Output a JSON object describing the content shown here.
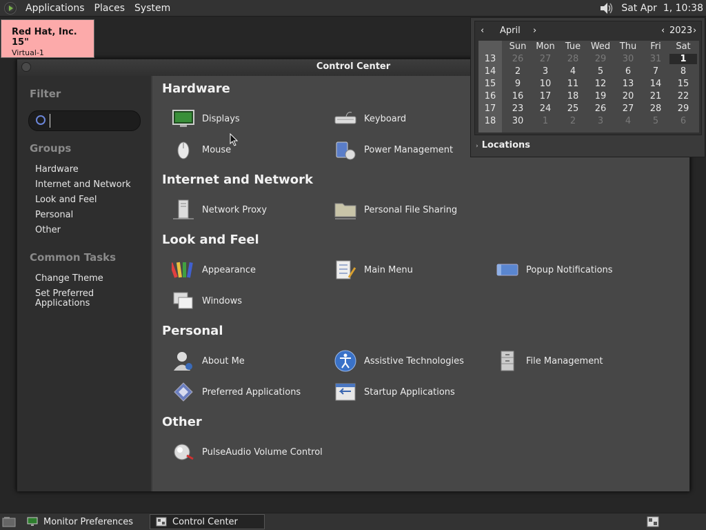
{
  "top_panel": {
    "menus": [
      "Applications",
      "Places",
      "System"
    ],
    "clock": "Sat Apr  1, 10:38"
  },
  "monitor_label": {
    "title": "Red Hat, Inc. 15\"",
    "subtitle": "Virtual-1"
  },
  "window": {
    "title": "Control Center"
  },
  "sidebar": {
    "filter_heading": "Filter",
    "search_value": "",
    "groups_heading": "Groups",
    "groups": [
      "Hardware",
      "Internet and Network",
      "Look and Feel",
      "Personal",
      "Other"
    ],
    "tasks_heading": "Common Tasks",
    "tasks": [
      "Change Theme",
      "Set Preferred Applications"
    ]
  },
  "main": {
    "sections": [
      {
        "title": "Hardware",
        "items": [
          "Displays",
          "Keyboard",
          "Mouse",
          "Power Management"
        ]
      },
      {
        "title": "Internet and Network",
        "items": [
          "Network Proxy",
          "Personal File Sharing"
        ]
      },
      {
        "title": "Look and Feel",
        "items": [
          "Appearance",
          "Main Menu",
          "Popup Notifications",
          "Windows"
        ]
      },
      {
        "title": "Personal",
        "items": [
          "About Me",
          "Assistive Technologies",
          "File Management",
          "Preferred Applications",
          "Startup Applications"
        ]
      },
      {
        "title": "Other",
        "items": [
          "PulseAudio Volume Control"
        ]
      }
    ]
  },
  "calendar": {
    "month": "April",
    "year": "2023",
    "weekdays": [
      "Sun",
      "Mon",
      "Tue",
      "Wed",
      "Thu",
      "Fri",
      "Sat"
    ],
    "weeks": [
      "13",
      "14",
      "15",
      "16",
      "17",
      "18"
    ],
    "days": [
      [
        "26",
        "27",
        "28",
        "29",
        "30",
        "31",
        "1"
      ],
      [
        "2",
        "3",
        "4",
        "5",
        "6",
        "7",
        "8"
      ],
      [
        "9",
        "10",
        "11",
        "12",
        "13",
        "14",
        "15"
      ],
      [
        "16",
        "17",
        "18",
        "19",
        "20",
        "21",
        "22"
      ],
      [
        "23",
        "24",
        "25",
        "26",
        "27",
        "28",
        "29"
      ],
      [
        "30",
        "1",
        "2",
        "3",
        "4",
        "5",
        "6"
      ]
    ],
    "locations_label": "Locations"
  },
  "taskbar": {
    "tasks": [
      "Monitor Preferences",
      "Control Center"
    ]
  }
}
